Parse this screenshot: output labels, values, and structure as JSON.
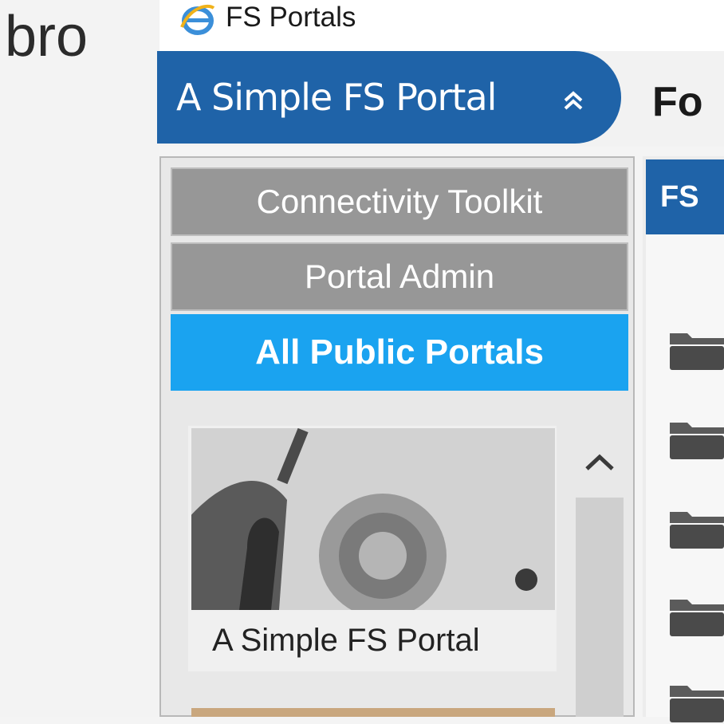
{
  "background": {
    "cropped_word": "bro"
  },
  "window": {
    "title": "FS Portals",
    "icon": "internet-explorer-icon"
  },
  "header": {
    "portal_tab_label": "A Simple FS Portal",
    "collapse_icon": "double-chevron-up-icon",
    "title_partial": "Fo"
  },
  "left_nav": {
    "items": [
      {
        "label": "Connectivity Toolkit",
        "active": false
      },
      {
        "label": "Portal Admin",
        "active": false
      },
      {
        "label": "All Public Portals",
        "active": true
      }
    ]
  },
  "portal_list": {
    "cards": [
      {
        "label": "A Simple FS Portal"
      }
    ],
    "scroll_up_icon": "chevron-up-icon"
  },
  "content": {
    "tab_label_partial": "FS",
    "folder_icon": "folder-icon"
  },
  "colors": {
    "accent_blue": "#1f63a8",
    "active_nav": "#1aa3f0",
    "inactive_nav": "#979797"
  }
}
